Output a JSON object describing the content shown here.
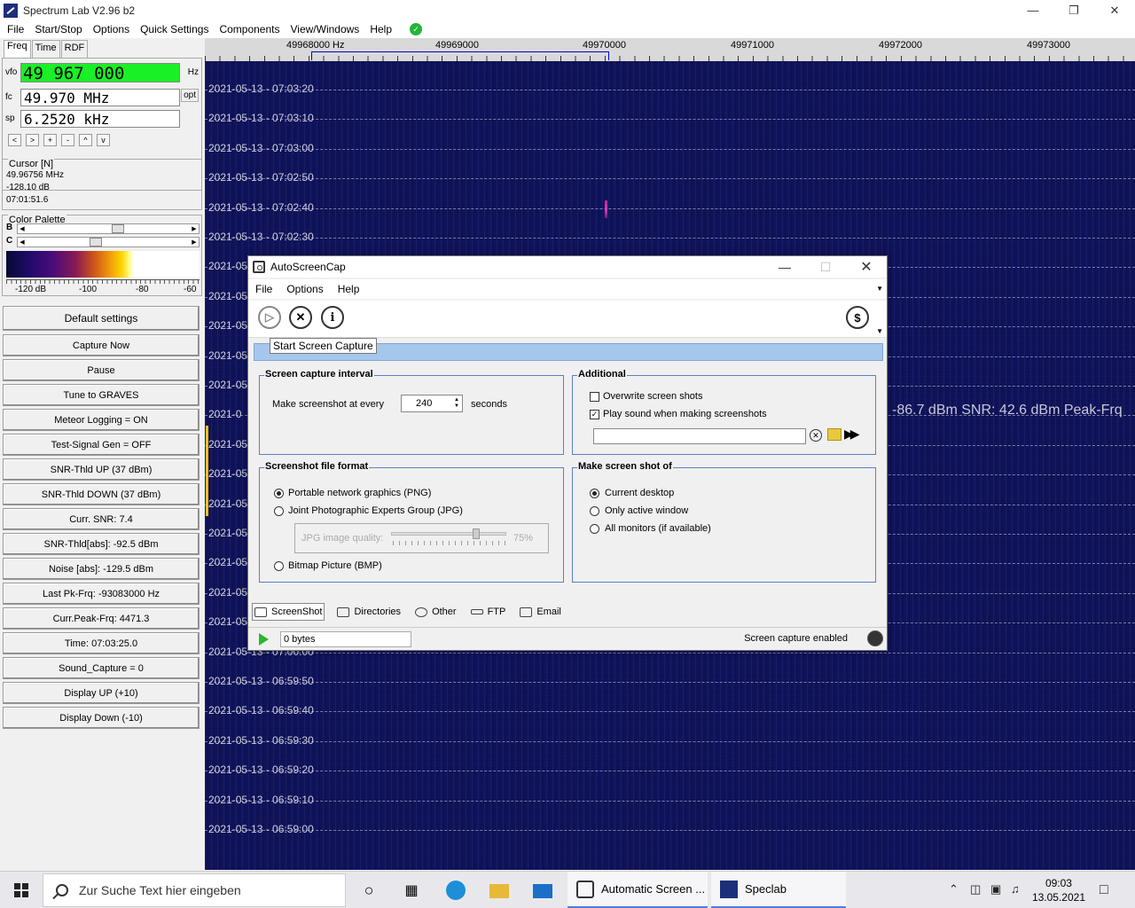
{
  "window": {
    "title": "Spectrum Lab V2.96 b2"
  },
  "menu": {
    "items": [
      {
        "label": "File"
      },
      {
        "label": "Start/Stop"
      },
      {
        "label": "Options"
      },
      {
        "label": "Quick Settings"
      },
      {
        "label": "Components"
      },
      {
        "label": "View/Windows"
      },
      {
        "label": "Help"
      }
    ]
  },
  "left": {
    "tabs": [
      "Freq",
      "Time",
      "RDF"
    ],
    "vfo_label": "vfo",
    "vfo_value": "49 967 000",
    "hz_label": "Hz",
    "fc_label": "fc",
    "fc_value": "49.970 MHz",
    "opt_label": "opt",
    "sp_label": "sp",
    "sp_value": "6.2520 kHz",
    "nav_buttons": [
      "<",
      ">",
      "+",
      "-",
      "^",
      "v"
    ],
    "cursor": {
      "legend": "Cursor [N]",
      "freq": "49.96756 MHz",
      "level": "-128.10 dB",
      "time": "07:01:51.6"
    },
    "palette": {
      "legend": "Color Palette",
      "b_label": "B",
      "c_label": "C",
      "b_level": 0.55,
      "c_level": 0.42,
      "db_labels": [
        "-120 dB",
        "-100",
        "-80",
        "-60"
      ]
    },
    "buttons": [
      "Default settings",
      "Capture Now",
      "Pause",
      "Tune to GRAVES",
      "Meteor Logging = ON",
      "Test-Signal Gen = OFF",
      "SNR-Thld UP (37 dBm)",
      "SNR-Thld DOWN (37 dBm)",
      "Curr. SNR: 7.4",
      "SNR-Thld[abs]: -92.5 dBm",
      "Noise [abs]: -129.5 dBm",
      "Last Pk-Frq: -93083000 Hz",
      "Curr.Peak-Frq: 4471.3",
      "Time:  07:03:25.0",
      "Sound_Capture = 0",
      "Display UP (+10)",
      "Display Down (-10)"
    ]
  },
  "waterfall": {
    "freq_labels": [
      "49968000 Hz",
      "49969000",
      "49970000",
      "49971000",
      "49972000",
      "49973000"
    ],
    "timestamps": [
      "2021-05-13 - 07:03:20",
      "2021-05-13 - 07:03:10",
      "2021-05-13 - 07:03:00",
      "2021-05-13 - 07:02:50",
      "2021-05-13 - 07:02:40",
      "2021-05-13 - 07:02:30",
      "2021-05",
      "2021-05",
      "2021-05",
      "2021-05",
      "2021-05",
      "2021-0",
      "2021-05",
      "2021-05",
      "2021-05",
      "2021-05",
      "2021-05",
      "2021-05",
      "2021-05",
      "2021-05-13 - 07:00:00",
      "2021-05-13 - 06:59:50",
      "2021-05-13 - 06:59:40",
      "2021-05-13 - 06:59:30",
      "2021-05-13 - 06:59:20",
      "2021-05-13 - 06:59:10",
      "2021-05-13 - 06:59:00"
    ],
    "overlay": "-86.7 dBm   SNR: 42.6 dBm   Peak-Frq"
  },
  "autoscreencap": {
    "title": "AutoScreenCap",
    "menu": [
      "File",
      "Options",
      "Help"
    ],
    "tooltip": "Start Screen Capture",
    "interval": {
      "legend": "Screen capture interval",
      "label": "Make screenshot at every",
      "value": "240",
      "unit": "seconds"
    },
    "additional": {
      "legend": "Additional",
      "overwrite": "Overwrite screen shots",
      "overwrite_checked": false,
      "play_sound": "Play sound when making screenshots",
      "play_sound_checked": true
    },
    "format": {
      "legend": "Screenshot file format",
      "png": "Portable network graphics (PNG)",
      "jpg": "Joint Photographic Experts Group (JPG)",
      "jpg_quality_label": "JPG image quality:",
      "jpg_quality_value": "75%",
      "jpg_quality": 0.75,
      "bmp": "Bitmap Picture (BMP)",
      "selected": "png"
    },
    "target": {
      "legend": "Make screen shot of",
      "current_desktop": "Current desktop",
      "active_window": "Only active window",
      "all_monitors": "All monitors (if available)",
      "selected": "current_desktop"
    },
    "tabs": [
      "ScreenShot",
      "Directories",
      "Other",
      "FTP",
      "Email"
    ],
    "status": {
      "bytes": "0 bytes",
      "text": "Screen capture enabled"
    }
  },
  "taskbar": {
    "search_placeholder": "Zur Suche Text hier eingeben",
    "apps": [
      "Automatic Screen ...",
      "Speclab"
    ],
    "time": "09:03",
    "date": "13.05.2021"
  },
  "colors": {
    "vfo_bg": "#19f026",
    "waterfall_bg": "#0e1054",
    "group_border": "#5a7fc8",
    "tab_bar": "#a6c7ec"
  }
}
